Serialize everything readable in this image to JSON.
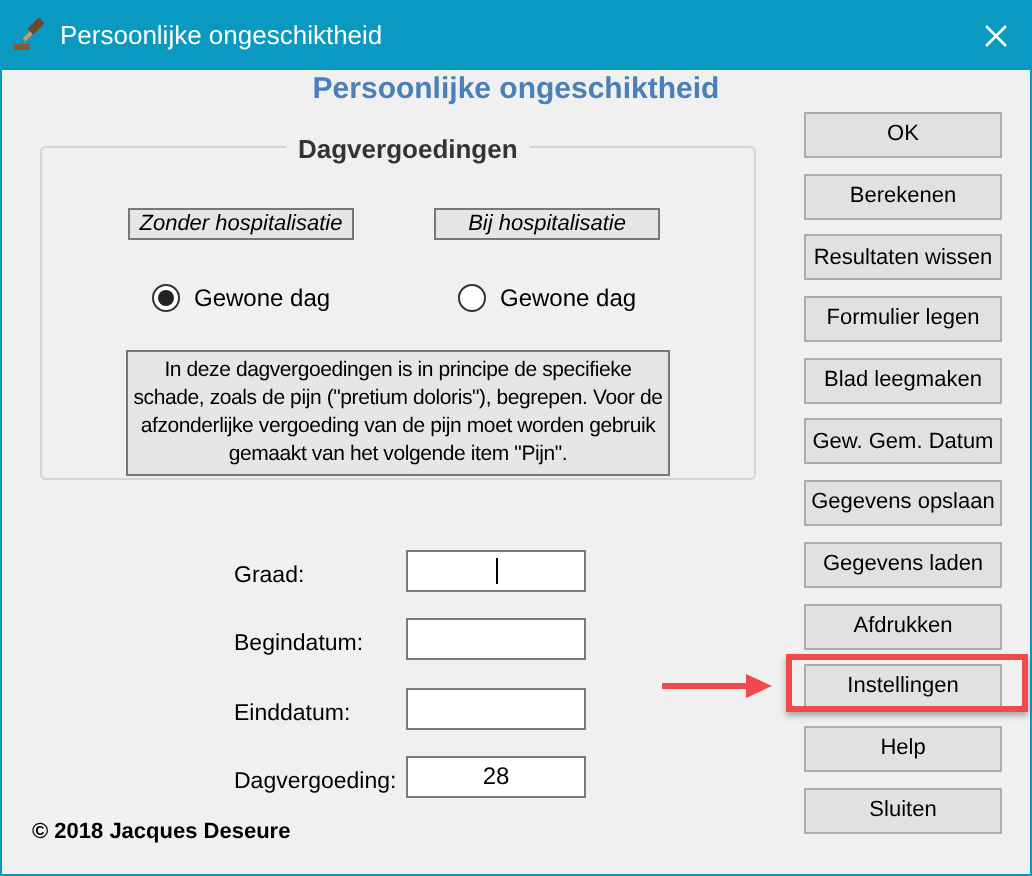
{
  "window": {
    "title": "Persoonlijke ongeschiktheid"
  },
  "heading": "Persoonlijke ongeschiktheid",
  "group": {
    "legend": "Dagvergoedingen",
    "columns": [
      {
        "label": "Zonder hospitalisatie",
        "radio": {
          "label": "Gewone dag",
          "selected": true
        }
      },
      {
        "label": "Bij hospitalisatie",
        "radio": {
          "label": "Gewone dag",
          "selected": false
        }
      }
    ],
    "note": "In deze dagvergoedingen is in principe de specifieke schade, zoals de pijn (\"pretium doloris\"), begrepen. Voor de afzonderlijke vergoeding van de pijn moet worden gebruik gemaakt van het volgende item \"Pijn\"."
  },
  "fields": [
    {
      "label": "Graad:",
      "focused": true
    },
    {
      "label": "Begindatum:",
      "focused": false
    },
    {
      "label": "Einddatum:",
      "focused": false
    },
    {
      "label": "Dagvergoeding:",
      "value": "28",
      "focused": false
    }
  ],
  "copyright": "© 2018 Jacques Deseure",
  "buttons": [
    {
      "label": "OK",
      "highlighted": false
    },
    {
      "label": "Berekenen",
      "highlighted": false
    },
    {
      "label": "Resultaten wissen",
      "highlighted": false
    },
    {
      "label": "Formulier legen",
      "highlighted": false
    },
    {
      "label": "Blad leegmaken",
      "highlighted": false
    },
    {
      "label": "Gew. Gem. Datum",
      "highlighted": false
    },
    {
      "label": "Gegevens opslaan",
      "highlighted": false
    },
    {
      "label": "Gegevens laden",
      "highlighted": false
    },
    {
      "label": "Afdrukken",
      "highlighted": false
    },
    {
      "label": "Instellingen",
      "highlighted": true
    },
    {
      "label": "Help",
      "highlighted": false
    },
    {
      "label": "Sluiten",
      "highlighted": false
    }
  ]
}
